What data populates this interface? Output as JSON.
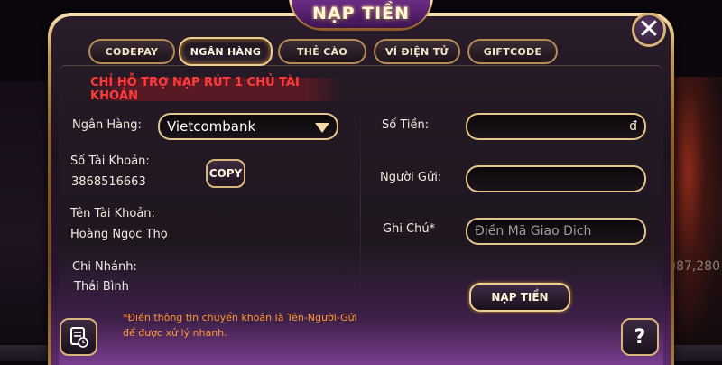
{
  "dialog": {
    "title": "NẠP TIỀN"
  },
  "tabs": [
    {
      "label": "CODEPAY",
      "active": false
    },
    {
      "label": "NGÂN HÀNG",
      "active": true
    },
    {
      "label": "THẺ CÀO",
      "active": false
    },
    {
      "label": "VÍ ĐIỆN TỬ",
      "active": false
    },
    {
      "label": "GIFTCODE",
      "active": false
    }
  ],
  "warning": "CHỈ HỖ TRỢ NẠP RÚT 1 CHỦ TÀI KHOẢN",
  "bank_info": {
    "bank_label": "Ngân Hàng:",
    "bank_selected": "Vietcombank",
    "account_number_label": "Số Tài Khoản:",
    "account_number": "3868516663",
    "copy_label": "COPY",
    "account_name_label": "Tên Tài Khoản:",
    "account_name": "Hoàng Ngọc Thọ",
    "branch_label": "Chi Nhánh:",
    "branch": "Thái Bình"
  },
  "form": {
    "amount_label": "Số Tiền:",
    "amount_value": "",
    "currency": "đ",
    "sender_label": "Người Gửi:",
    "sender_value": "",
    "note_label": "Ghi Chú*",
    "note_placeholder": "Điền Mã Giao Dich",
    "submit_label": "NẠP TIỀN"
  },
  "footer_note": {
    "line1": "*Điền thông tin chuyển khoản là Tên-Người-Gửi",
    "line2": "để được xử lý nhanh."
  },
  "background": {
    "right_number": "087,280"
  },
  "icons": {
    "close": "close-icon",
    "dropdown": "chevron-down-icon",
    "history": "history-icon",
    "help": "help-icon"
  },
  "colors": {
    "accent_gold": "#e3c58d",
    "warning_red": "#ff3b3b",
    "note_orange": "#ff9a2e",
    "title_purple": "#6d2d86"
  }
}
